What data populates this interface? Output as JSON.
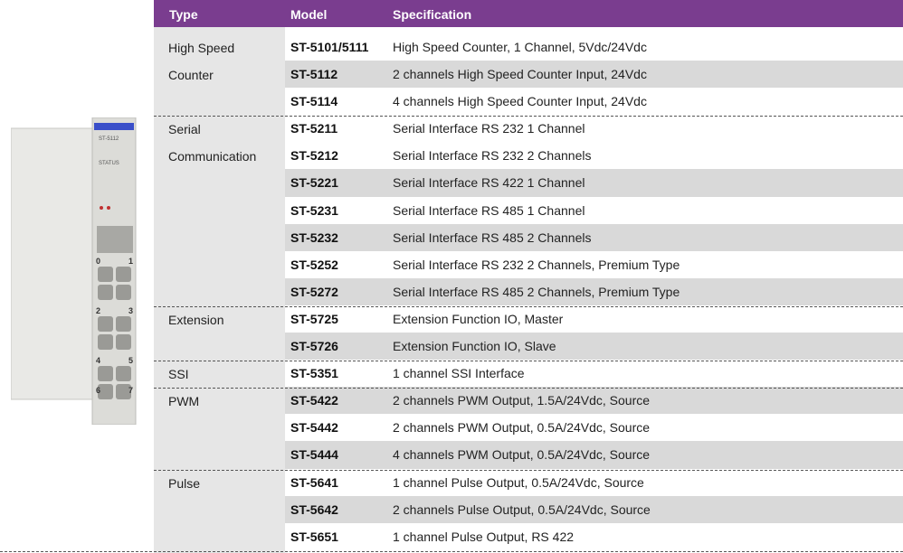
{
  "headers": {
    "type": "Type",
    "model": "Model",
    "specification": "Specification"
  },
  "type_groups": [
    {
      "lines": [
        "High Speed",
        "Counter"
      ]
    },
    {
      "lines": [
        "Serial",
        "Communication"
      ]
    },
    {
      "lines": [
        "Extension"
      ]
    },
    {
      "lines": [
        "SSI"
      ]
    },
    {
      "lines": [
        "PWM"
      ]
    },
    {
      "lines": [
        "Pulse"
      ]
    }
  ],
  "rows": [
    {
      "model": "ST-5101/5111",
      "spec": "High Speed Counter, 1 Channel, 5Vdc/24Vdc"
    },
    {
      "model": "ST-5112",
      "spec": "2 channels High Speed Counter Input, 24Vdc"
    },
    {
      "model": "ST-5114",
      "spec": "4 channels High Speed Counter Input, 24Vdc"
    },
    {
      "model": "ST-5211",
      "spec": "Serial Interface RS 232 1 Channel"
    },
    {
      "model": "ST-5212",
      "spec": "Serial Interface RS 232 2 Channels"
    },
    {
      "model": "ST-5221",
      "spec": "Serial Interface RS 422 1 Channel"
    },
    {
      "model": "ST-5231",
      "spec": "Serial Interface RS 485 1 Channel"
    },
    {
      "model": "ST-5232",
      "spec": "Serial Interface RS 485 2 Channels"
    },
    {
      "model": "ST-5252",
      "spec": "Serial Interface RS 232 2 Channels, Premium Type"
    },
    {
      "model": "ST-5272",
      "spec": "Serial Interface RS 485 2 Channels, Premium Type"
    },
    {
      "model": "ST-5725",
      "spec": "Extension Function IO, Master"
    },
    {
      "model": "ST-5726",
      "spec": "Extension Function IO, Slave"
    },
    {
      "model": "ST-5351",
      "spec": "1 channel SSI Interface"
    },
    {
      "model": "ST-5422",
      "spec": "2 channels PWM Output, 1.5A/24Vdc, Source"
    },
    {
      "model": "ST-5442",
      "spec": "2 channels PWM Output, 0.5A/24Vdc, Source"
    },
    {
      "model": "ST-5444",
      "spec": "4 channels PWM Output, 0.5A/24Vdc, Source"
    },
    {
      "model": "ST-5641",
      "spec": "1 channel Pulse  Output, 0.5A/24Vdc, Source"
    },
    {
      "model": "ST-5642",
      "spec": "2 channels Pulse  Output, 0.5A/24Vdc, Source"
    },
    {
      "model": "ST-5651",
      "spec": "1 channel Pulse  Output, RS 422"
    }
  ],
  "device": {
    "label": "ST-5112",
    "status_label": "STATUS",
    "terminals": [
      "0",
      "1",
      "2",
      "3",
      "4",
      "5",
      "6",
      "7"
    ]
  },
  "colors": {
    "header_bg": "#7a3d8f",
    "row_shade": "#d9d9d9",
    "type_column": "#e6e6e6"
  }
}
